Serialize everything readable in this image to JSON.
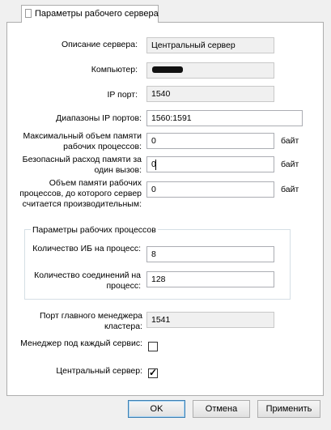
{
  "tab": {
    "label": "Параметры рабочего сервера",
    "active": true
  },
  "fields": {
    "server_description": {
      "label": "Описание сервера:",
      "value": "Центральный сервер"
    },
    "computer": {
      "label": "Компьютер:",
      "value": ""
    },
    "ip_port": {
      "label": "IP порт:",
      "value": "1540"
    },
    "ip_port_ranges": {
      "label": "Диапазоны IP портов:",
      "value": "1560:1591"
    },
    "max_memory": {
      "label": "Максимальный объем памяти рабочих процессов:",
      "value": "0",
      "unit": "байт"
    },
    "safe_memory": {
      "label": "Безопасный расход памяти за один вызов:",
      "value": "0",
      "unit": "байт"
    },
    "productive_memory": {
      "label": "Объем памяти рабочих процессов, до которого сервер считается производительным:",
      "value": "0",
      "unit": "байт"
    }
  },
  "process_group": {
    "title": "Параметры рабочих процессов",
    "ib_per_process": {
      "label": "Количество ИБ на процесс:",
      "value": "8"
    },
    "connections_per_process": {
      "label": "Количество соединений на процесс:",
      "value": "128"
    }
  },
  "cluster_manager_port": {
    "label": "Порт главного менеджера кластера:",
    "value": "1541"
  },
  "manager_per_service": {
    "label": "Менеджер под каждый сервис:",
    "checked": false
  },
  "central_server": {
    "label": "Центральный сервер:",
    "checked": true,
    "mark": "✓"
  },
  "buttons": {
    "ok": "OK",
    "cancel": "Отмена",
    "apply": "Применить"
  }
}
